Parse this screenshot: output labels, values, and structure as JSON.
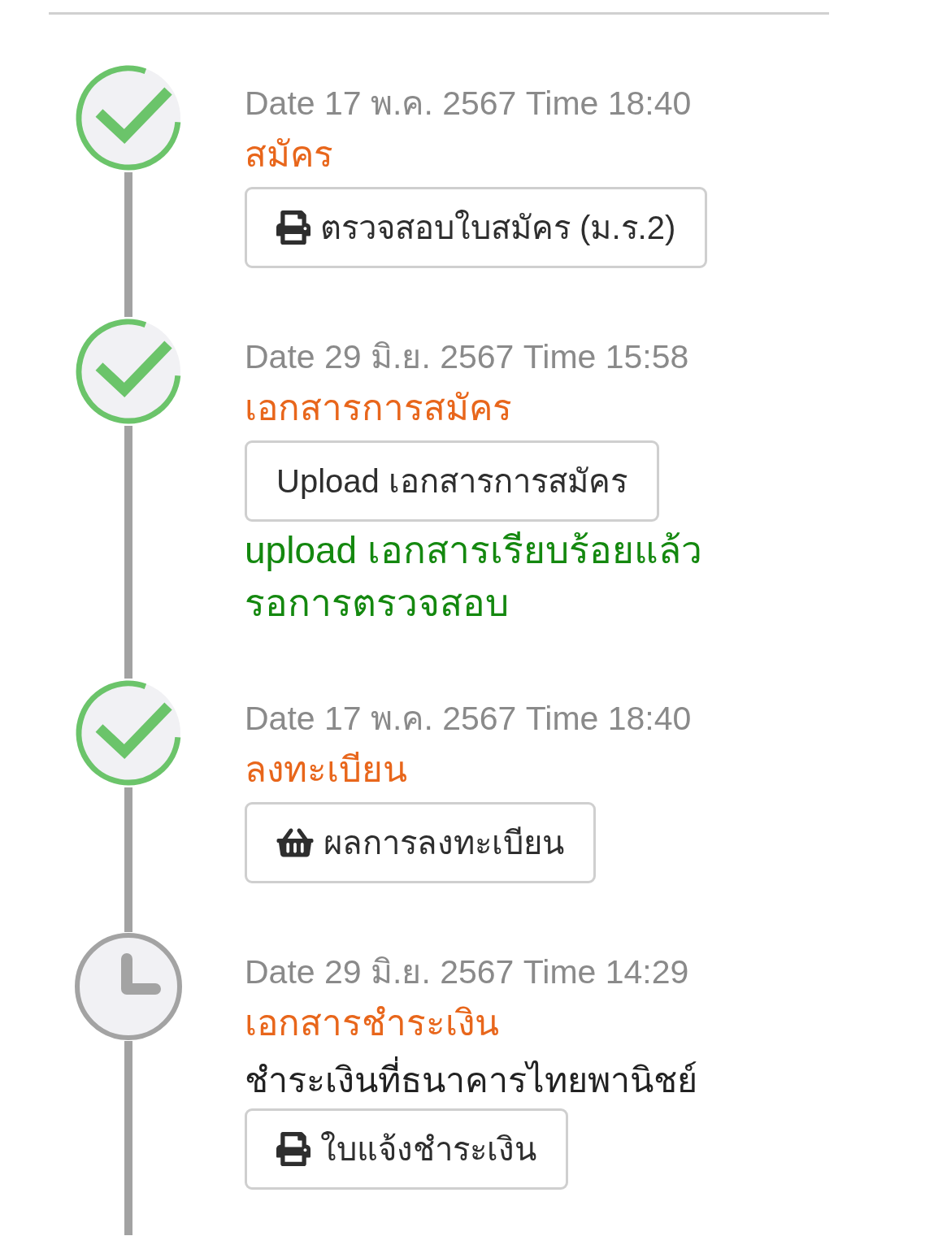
{
  "steps": [
    {
      "completed": true,
      "date": "Date 17 พ.ค. 2567 Time 18:40",
      "title": "สมัคร",
      "button": {
        "kind": "print",
        "label": "ตรวจสอบใบสมัคร (ม.ร.2)"
      }
    },
    {
      "completed": true,
      "date": "Date 29 มิ.ย. 2567 Time 15:58",
      "title": "เอกสารการสมัคร",
      "button": {
        "kind": "text",
        "label": "Upload เอกสารการสมัคร"
      },
      "note_lines": [
        "upload เอกสารเรียบร้อยแล้ว",
        "รอการตรวจสอบ"
      ]
    },
    {
      "completed": true,
      "date": "Date 17 พ.ค. 2567 Time 18:40",
      "title": "ลงทะเบียน",
      "button": {
        "kind": "basket",
        "label": "ผลการลงทะเบียน"
      }
    },
    {
      "completed": false,
      "date": "Date 29 มิ.ย. 2567 Time 14:29",
      "title": "เอกสารชำระเงิน",
      "description": "ชำระเงินที่ธนาคารไทยพานิชย์",
      "button": {
        "kind": "print",
        "label": "ใบแจ้งชำระเงิน"
      }
    }
  ]
}
